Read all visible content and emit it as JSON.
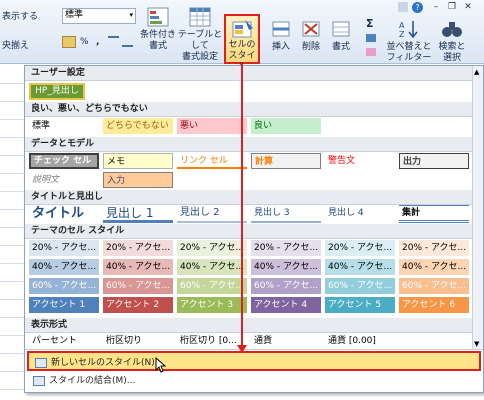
{
  "ribbon": {
    "wrap_text": "表示する",
    "merge_center": "央揃え",
    "number_format": "標準",
    "percent": "%",
    "comma": ",",
    "conditional_format": [
      "条件付き",
      "書式"
    ],
    "table_format": [
      "テーブルとして",
      "書式設定"
    ],
    "cell_styles": [
      "セルの",
      "スタイル"
    ],
    "insert": "挿入",
    "delete": "削除",
    "format": "書式",
    "sigma": "Σ",
    "sort_filter": [
      "並べ替えと",
      "フィルター"
    ],
    "find_select": [
      "検索と",
      "選択"
    ]
  },
  "gallery": {
    "sections": {
      "user": "ユーザー設定",
      "good_bad": "良い、悪い、どちらでもない",
      "data_model": "データとモデル",
      "titles": "タイトルと見出し",
      "themed": "テーマのセル スタイル",
      "number_format": "表示形式"
    },
    "user_styles": [
      "HP_見出し"
    ],
    "good_bad": [
      "標準",
      "どちらでもない",
      "悪い",
      "良い"
    ],
    "data_model_row1": [
      "チェック セル",
      "メモ",
      "リンク セル",
      "計算",
      "警告文",
      "出力"
    ],
    "data_model_row2": [
      "説明文",
      "入力"
    ],
    "titles": [
      "タイトル",
      "見出し 1",
      "見出し 2",
      "見出し 3",
      "見出し 4",
      "集計"
    ],
    "theme_rows": [
      [
        "20% - アクセ...",
        "20% - アクセ...",
        "20% - アクセ...",
        "20% - アクセ...",
        "20% - アクセ...",
        "20% - アクセ..."
      ],
      [
        "40% - アクセ...",
        "40% - アクセ...",
        "40% - アクセ...",
        "40% - アクセ...",
        "40% - アクセ...",
        "40% - アクセ..."
      ],
      [
        "60% - アクセ...",
        "60% - アクセ...",
        "60% - アクセ...",
        "60% - アクセ...",
        "60% - アクセ...",
        "60% - アクセ..."
      ],
      [
        "アクセント 1",
        "アクセント 2",
        "アクセント 3",
        "アクセント 4",
        "アクセント 5",
        "アクセント 6"
      ]
    ],
    "number_styles": [
      "パーセント",
      "桁区切り",
      "桁区切り [0...",
      "通貨",
      "通貨 [0.00]"
    ],
    "menu": {
      "new_style": "新しいセルのスタイル(N)...",
      "merge_styles": "スタイルの結合(M)..."
    }
  },
  "colors": {
    "accent": [
      "#4f81bd",
      "#c0504d",
      "#9bbb59",
      "#8064a2",
      "#4bacc6",
      "#f79646"
    ],
    "c20": [
      "#dce6f1",
      "#f2dcdb",
      "#ebf1de",
      "#e4dfec",
      "#daeef3",
      "#fde9d9"
    ],
    "c40": [
      "#b8cce4",
      "#e6b8b7",
      "#d8e4bc",
      "#ccc0da",
      "#b7dee8",
      "#fcd5b4"
    ],
    "c60": [
      "#95b3d7",
      "#da9694",
      "#c4d79b",
      "#b1a0c7",
      "#92cddc",
      "#fabf8f"
    ],
    "highlight": "#e02020"
  }
}
